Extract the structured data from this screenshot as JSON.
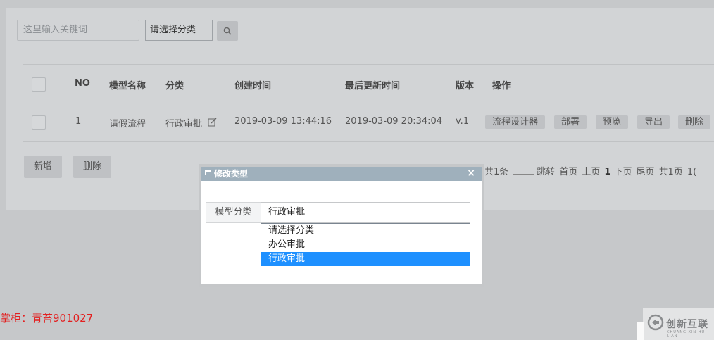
{
  "search": {
    "placeholder": "这里输入关键词",
    "category_selected": "请选择分类"
  },
  "table": {
    "headers": [
      "NO",
      "模型名称",
      "分类",
      "创建时间",
      "最后更新时间",
      "版本",
      "操作"
    ],
    "rows": [
      {
        "no": "1",
        "name": "请假流程",
        "category": "行政审批",
        "created": "2019-03-09 13:44:16",
        "updated": "2019-03-09 20:34:04",
        "version": "v.1",
        "actions": [
          "流程设计器",
          "部署",
          "预览",
          "导出",
          "删除"
        ]
      }
    ]
  },
  "toolbar": {
    "add_label": "新增",
    "delete_label": "删除"
  },
  "pager": {
    "total": "共1条",
    "jump": "跳转",
    "first": "首页",
    "prev": "上页",
    "current": "1",
    "next": "下页",
    "last": "尾页",
    "pages": "共1页",
    "tail": "1("
  },
  "modal": {
    "title": "修改类型",
    "close": "×",
    "field_label": "模型分类",
    "selected": "行政审批",
    "options": [
      "请选择分类",
      "办公审批",
      "行政审批"
    ]
  },
  "footer": {
    "shopkeeper": "掌柜：青苔901027"
  },
  "watermark": {
    "text": "创新互联",
    "subtext": "CHUANG XIN HU LIAN"
  },
  "colors": {
    "selected_option": "#1e90ff",
    "modal_title_bar": "#9fb0bc",
    "shopkeeper": "#e32020"
  },
  "icons": [
    "search-icon",
    "edit-icon",
    "window-icon",
    "close-icon",
    "watermark-logo-icon"
  ]
}
